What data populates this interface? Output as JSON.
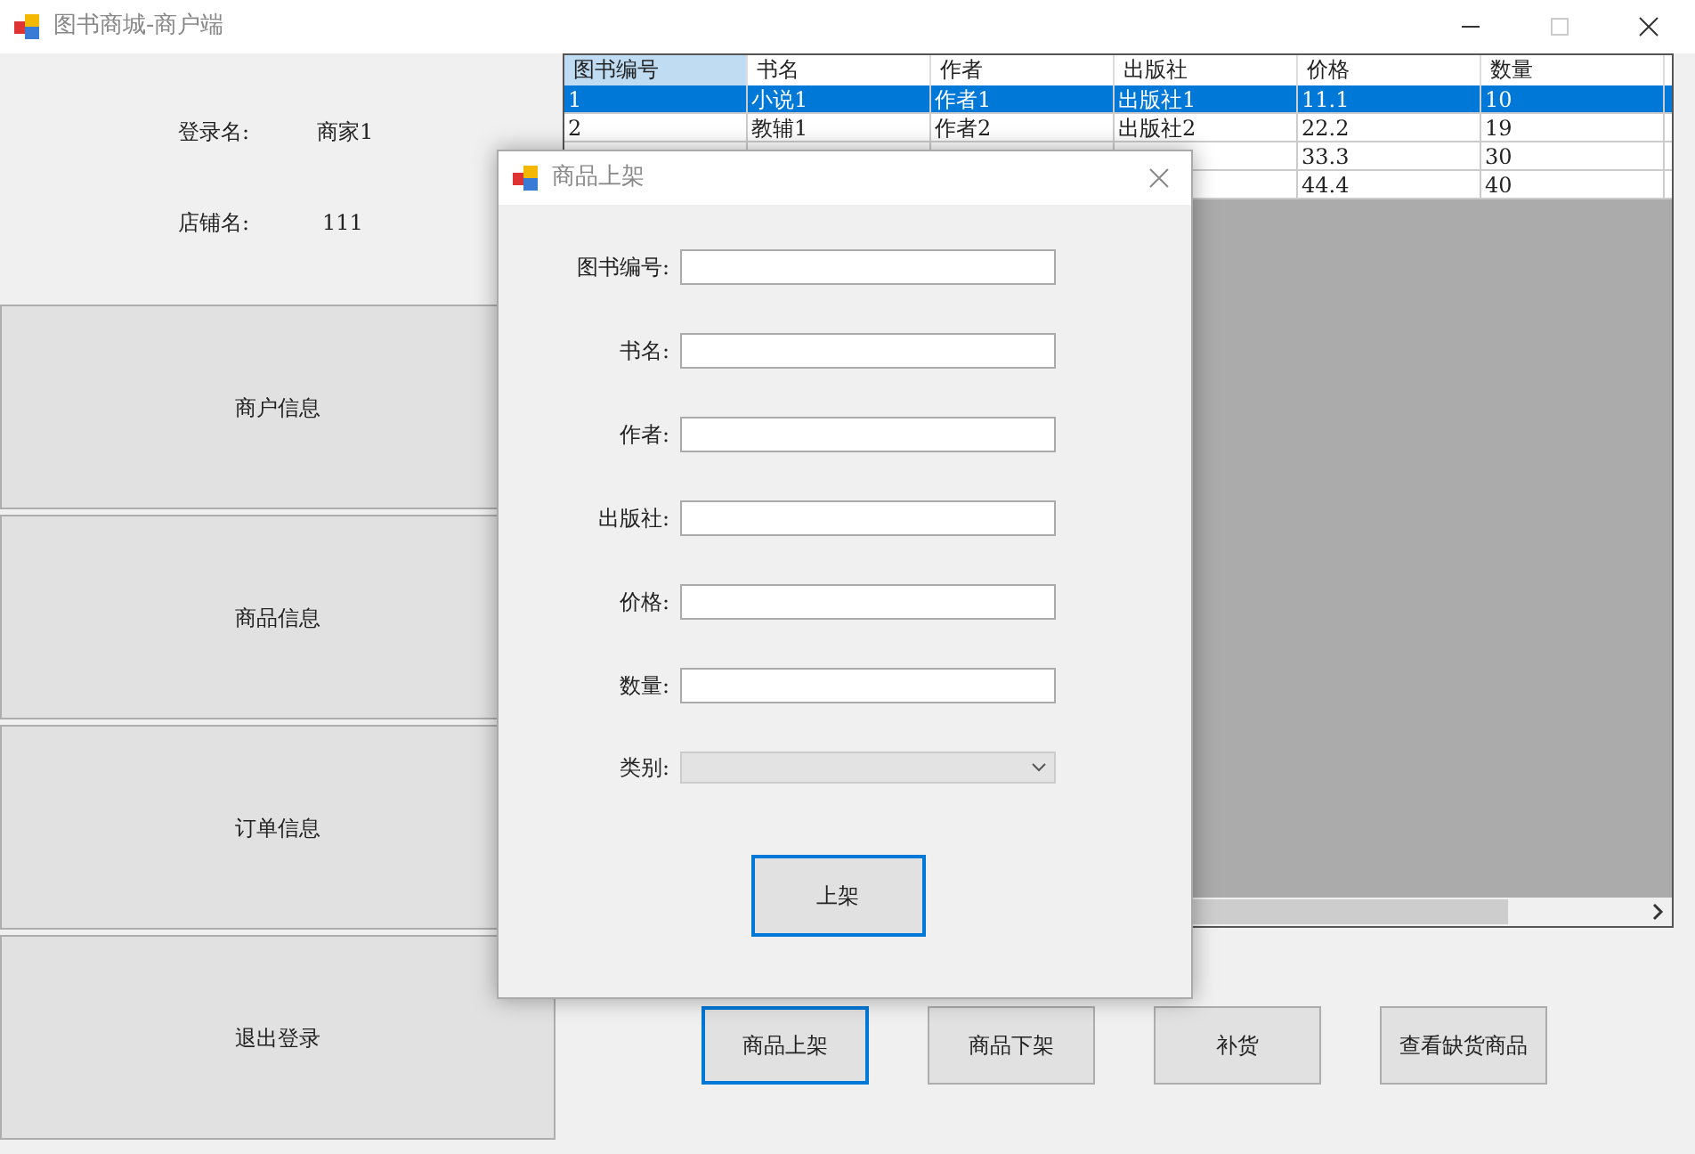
{
  "window": {
    "title": "图书商城-商户端"
  },
  "account": [
    {
      "label": "登录名:",
      "value": "商家1"
    },
    {
      "label": "店铺名:",
      "value": "111"
    }
  ],
  "nav_buttons": [
    "商户信息",
    "商品信息",
    "订单信息",
    "退出登录"
  ],
  "table": {
    "columns": [
      "图书编号",
      "书名",
      "作者",
      "出版社",
      "价格",
      "数量"
    ],
    "rows": [
      {
        "selected": true,
        "cells": [
          "1",
          "小说1",
          "作者1",
          "出版社1",
          "11.1",
          "10"
        ]
      },
      {
        "selected": false,
        "cells": [
          "2",
          "教辅1",
          "作者2",
          "出版社2",
          "22.2",
          "19"
        ]
      },
      {
        "selected": false,
        "cells": [
          "33.3",
          "30"
        ]
      },
      {
        "selected": false,
        "cells": [
          "44.4",
          "40"
        ]
      }
    ]
  },
  "action_buttons": [
    {
      "label": "商品上架",
      "focused": true
    },
    {
      "label": "商品下架",
      "focused": false
    },
    {
      "label": "补货",
      "focused": false
    },
    {
      "label": "查看缺货商品",
      "focused": false
    }
  ],
  "dialog": {
    "title": "商品上架",
    "fields": [
      {
        "kind": "text",
        "label": "图书编号:"
      },
      {
        "kind": "text",
        "label": "书名:"
      },
      {
        "kind": "text",
        "label": "作者:"
      },
      {
        "kind": "text",
        "label": "出版社:"
      },
      {
        "kind": "text",
        "label": "价格:"
      },
      {
        "kind": "text",
        "label": "数量:"
      },
      {
        "kind": "select",
        "label": "类别:",
        "disabled": true
      }
    ],
    "submit": {
      "label": "上架",
      "focused": true
    }
  }
}
